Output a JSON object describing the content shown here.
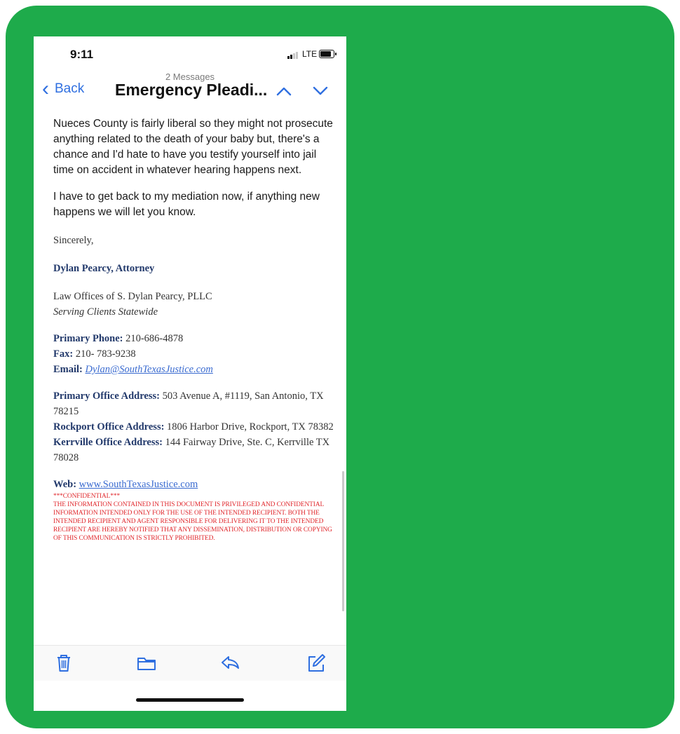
{
  "status_bar": {
    "time": "9:11",
    "network": "LTE"
  },
  "nav": {
    "back_label": "Back",
    "message_count": "2 Messages",
    "subject": "Emergency Pleadi..."
  },
  "email": {
    "paragraph_1": "Nueces County is fairly liberal so they might not prosecute anything related to the death of your baby but, there's a chance and I'd hate to have you testify yourself into jail time on accident in whatever hearing happens next.",
    "paragraph_2": "I have to get back to my mediation now, if anything new happens we will let you know.",
    "closing": "Sincerely,",
    "signature": {
      "name": "Dylan Pearcy, Attorney",
      "firm": "Law Offices of S. Dylan Pearcy, PLLC",
      "tagline": "Serving Clients Statewide",
      "primary_phone_label": "Primary Phone:",
      "primary_phone": "210-686-4878",
      "fax_label": "Fax:",
      "fax": "210- 783-9238",
      "email_label": "Email:",
      "email": "Dylan@SouthTexasJustice.com",
      "primary_office_label": "Primary Office Address:",
      "primary_office": "503 Avenue A, #1119, San Antonio, TX 78215",
      "rockport_office_label": "Rockport Office Address:",
      "rockport_office": "1806 Harbor Drive, Rockport, TX 78382",
      "kerrville_office_label": "Kerrville Office Address:",
      "kerrville_office": "144 Fairway Drive, Ste. C, Kerrville TX 78028",
      "web_label": "Web:",
      "web": "www.SouthTexasJustice.com"
    },
    "confidential_heading": "***CONFIDENTIAL***",
    "confidential_notice": "THE INFORMATION CONTAINED IN THIS DOCUMENT IS PRIVILEGED AND CONFIDENTIAL INFORMATION INTENDED ONLY FOR THE USE OF THE INTENDED RECIPIENT. BOTH THE INTENDED RECIPIENT AND AGENT RESPONSIBLE FOR DELIVERING IT TO THE INTENDED RECIPIENT ARE HEREBY NOTIFIED THAT ANY DISSEMINATION, DISTRIBUTION OR COPYING OF THIS COMMUNICATION IS STRICTLY PROHIBITED."
  },
  "toolbar": {
    "icons": [
      "trash-icon",
      "folder-icon",
      "reply-icon",
      "compose-icon"
    ]
  },
  "colors": {
    "frame_green": "#1eab4b",
    "ios_blue": "#2f6fe0",
    "signature_navy": "#22396b",
    "notice_red": "#e0262b"
  }
}
